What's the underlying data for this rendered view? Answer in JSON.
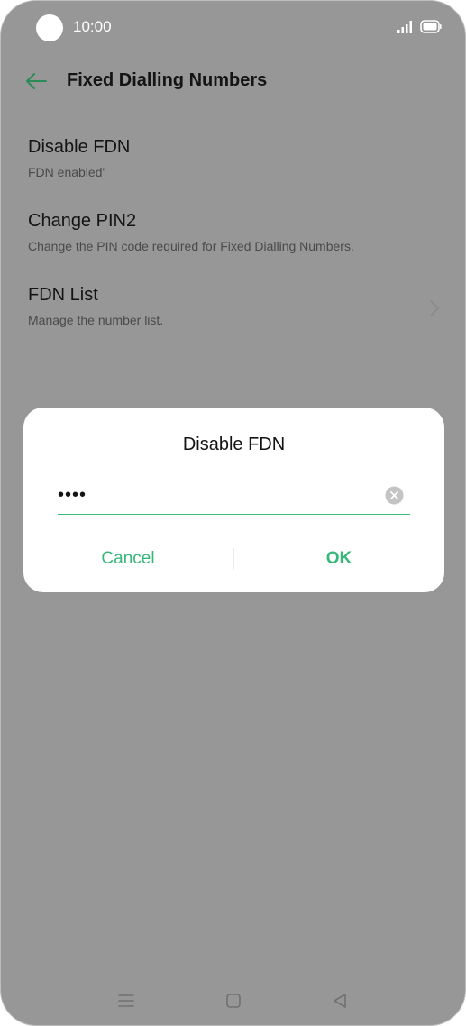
{
  "status_bar": {
    "time": "10:00",
    "icons": [
      "camera-cutout",
      "signal-icon",
      "battery-icon"
    ]
  },
  "toolbar": {
    "title": "Fixed Dialling Numbers",
    "back_icon": "arrow-left-icon"
  },
  "settings_items": [
    {
      "label": "Disable FDN",
      "sublabel": "FDN enabled'"
    },
    {
      "label": "Change PIN2",
      "sublabel": "Change the PIN code required for Fixed Dialling Numbers."
    },
    {
      "label": "FDN List",
      "sublabel": "Manage the number list.",
      "icon": "chevron-right-icon"
    }
  ],
  "dialog": {
    "title": "Disable FDN",
    "pin_value": "••••",
    "clear_icon": "clear-icon",
    "cancel_label": "Cancel",
    "ok_label": "OK"
  },
  "nav_bar": {
    "icons": [
      "menu-icon",
      "home-icon",
      "back-icon"
    ]
  },
  "colors": {
    "accent": "#37b779",
    "overlay": "#979797",
    "dialog_bg": "#ffffff",
    "text_primary": "#141414"
  }
}
